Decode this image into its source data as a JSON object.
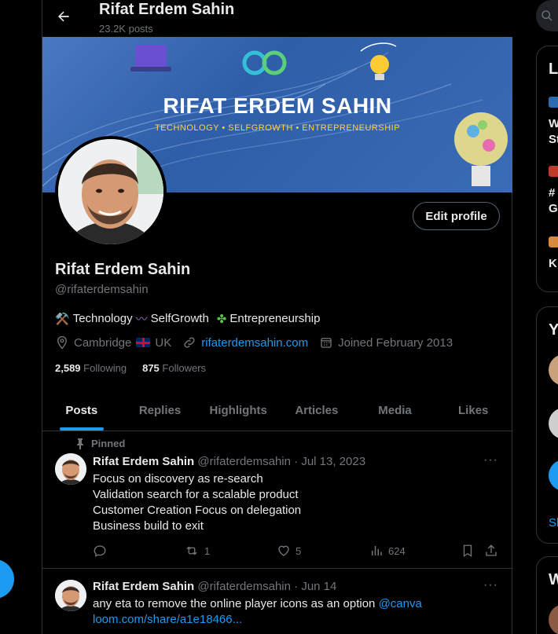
{
  "header": {
    "title": "Rifat Erdem Sahin",
    "post_count": "23.2K posts"
  },
  "banner": {
    "title": "RIFAT ERDEM SAHIN",
    "tagline": "TECHNOLOGY • SELFGROWTH • ENTREPRENEURSHIP"
  },
  "profile": {
    "edit_button": "Edit profile",
    "name": "Rifat Erdem Sahin",
    "handle": "@rifaterdemsahin",
    "bio": {
      "item1": "Technology",
      "item2": "SelfGrowth",
      "item3": "Entrepreneurship"
    },
    "location": "Cambridge",
    "location_suffix": "UK",
    "website": "rifaterdemsahin.com",
    "joined": "Joined February 2013",
    "following_count": "2,589",
    "following_label": "Following",
    "followers_count": "875",
    "followers_label": "Followers"
  },
  "tabs": [
    "Posts",
    "Replies",
    "Highlights",
    "Articles",
    "Media",
    "Likes"
  ],
  "posts": [
    {
      "pinned_label": "Pinned",
      "name": "Rifat Erdem Sahin",
      "handle_date": "@rifaterdemsahin · Jul 13, 2023",
      "lines": [
        "Focus on discovery as re-search",
        "Validation search for a scalable product",
        "Customer Creation Focus on delegation",
        "Business build to exit"
      ],
      "reposts": "1",
      "likes": "5",
      "views": "624"
    },
    {
      "name": "Rifat Erdem Sahin",
      "handle_date": "@rifaterdemsahin · Jun 14",
      "line1": "any eta to remove the online player icons as an option",
      "mention": "@canva",
      "link": "loom.com/share/a1e18466..."
    }
  ],
  "colors": {
    "accent": "#1d9bf0",
    "background": "#000000",
    "text": "#e7e9ea",
    "muted": "#71767b",
    "border": "#2f3336"
  },
  "icons": [
    "back-arrow-icon",
    "location-icon",
    "link-icon",
    "calendar-icon",
    "pin-icon",
    "reply-icon",
    "repost-icon",
    "like-icon",
    "views-icon",
    "bookmark-icon",
    "share-icon",
    "more-icon"
  ]
}
